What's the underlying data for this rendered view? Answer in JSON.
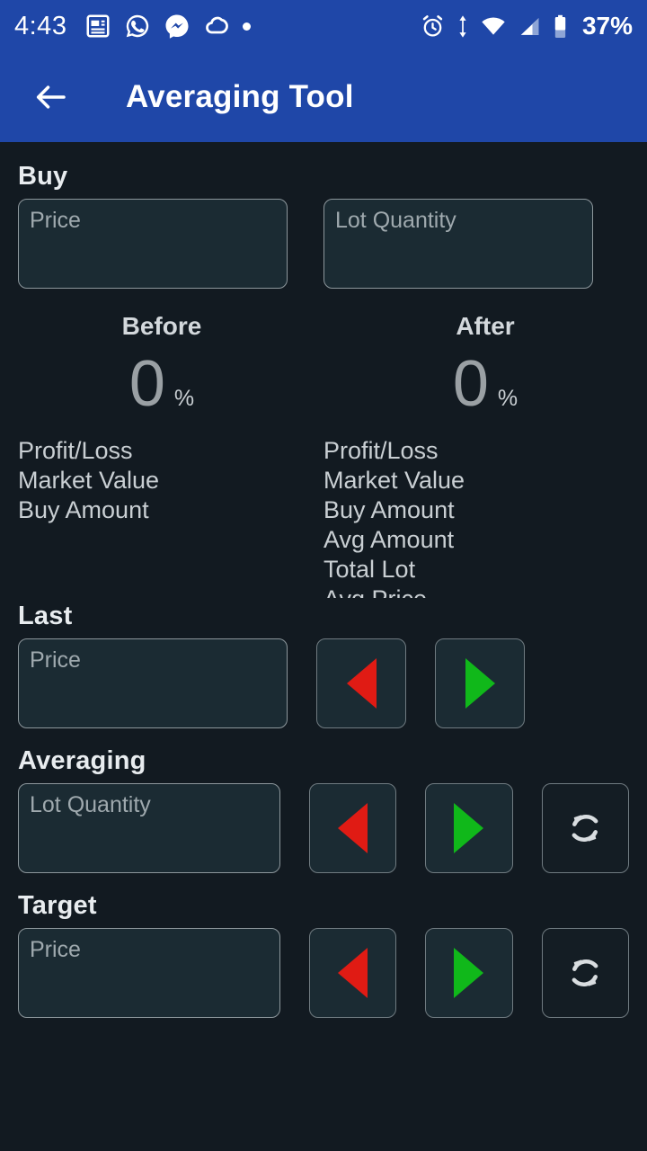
{
  "status_bar": {
    "time": "4:43",
    "left_icons": [
      "news-icon",
      "whatsapp-icon",
      "messenger-icon",
      "cloud-icon",
      "dot-icon"
    ],
    "right_icons": [
      "alarm-icon",
      "data-transfer-icon",
      "wifi-icon",
      "signal-icon",
      "battery-icon"
    ],
    "battery_percent": "37%"
  },
  "app_bar": {
    "back_icon": "back-arrow-icon",
    "title": "Averaging Tool"
  },
  "colors": {
    "brand_blue": "#1f47a8",
    "background": "#121a21",
    "field_fill": "#1b2b33",
    "field_border": "#8d979c",
    "red_arrow": "#e01b14",
    "green_arrow": "#10b81a"
  },
  "buy_section": {
    "label": "Buy",
    "price_placeholder": "Price",
    "price_value": "",
    "lot_placeholder": "Lot Quantity",
    "lot_value": ""
  },
  "summary": {
    "before": {
      "title": "Before",
      "percent_value": "0",
      "percent_symbol": "%",
      "metrics": [
        "Profit/Loss",
        "Market Value",
        "Buy Amount"
      ]
    },
    "after": {
      "title": "After",
      "percent_value": "0",
      "percent_symbol": "%",
      "metrics": [
        "Profit/Loss",
        "Market Value",
        "Buy Amount",
        "Avg Amount",
        "Total Lot",
        "Avg Price"
      ]
    }
  },
  "last_section": {
    "label": "Last",
    "price_placeholder": "Price",
    "price_value": "",
    "decrease_icon": "left-triangle-icon",
    "increase_icon": "right-triangle-icon"
  },
  "averaging_section": {
    "label": "Averaging",
    "lot_placeholder": "Lot Quantity",
    "lot_value": "",
    "decrease_icon": "left-triangle-icon",
    "increase_icon": "right-triangle-icon",
    "reset_icon": "sync-refresh-icon"
  },
  "target_section": {
    "label": "Target",
    "price_placeholder": "Price",
    "price_value": "",
    "decrease_icon": "left-triangle-icon",
    "increase_icon": "right-triangle-icon",
    "reset_icon": "sync-refresh-icon"
  }
}
